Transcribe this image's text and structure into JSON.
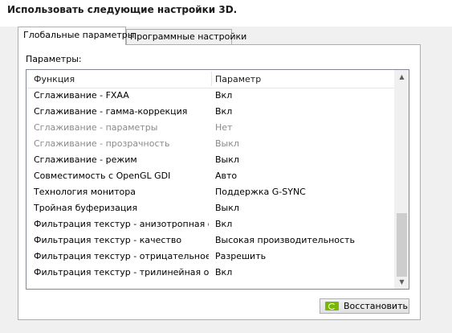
{
  "heading": "Использовать следующие настройки 3D.",
  "tabs": [
    {
      "label": "Глобальные параметры"
    },
    {
      "label": "Программные настройки"
    }
  ],
  "params_label": "Параметры:",
  "table": {
    "columns": [
      "Функция",
      "Параметр"
    ],
    "rows": [
      {
        "function": "Сглаживание - FXAA",
        "value": "Вкл"
      },
      {
        "function": "Сглаживание - гамма-коррекция",
        "value": "Вкл"
      },
      {
        "function": "Сглаживание - параметры",
        "value": "Нет"
      },
      {
        "function": "Сглаживание - прозрачность",
        "value": "Выкл"
      },
      {
        "function": "Сглаживание - режим",
        "value": "Выкл"
      },
      {
        "function": "Совместимость с OpenGL GDI",
        "value": "Авто"
      },
      {
        "function": "Технология монитора",
        "value": "Поддержка G-SYNC"
      },
      {
        "function": "Тройная буферизация",
        "value": "Выкл"
      },
      {
        "function": "Фильтрация текстур - анизотропная оп...",
        "value": "Вкл"
      },
      {
        "function": "Фильтрация текстур - качество",
        "value": "Высокая производительность"
      },
      {
        "function": "Фильтрация текстур - отрицательное о...",
        "value": "Разрешить"
      },
      {
        "function": "Фильтрация текстур - трилинейная опт...",
        "value": "Вкл"
      }
    ]
  },
  "scrollbar": {
    "up_icon": "arrow-up-icon",
    "down_icon": "arrow-down-icon"
  },
  "restore_button": {
    "label": "Восстановить",
    "icon": "nvidia-logo-icon"
  },
  "colors": {
    "nvidia_green": "#76b900",
    "disabled_text": "#8a8a8a"
  }
}
